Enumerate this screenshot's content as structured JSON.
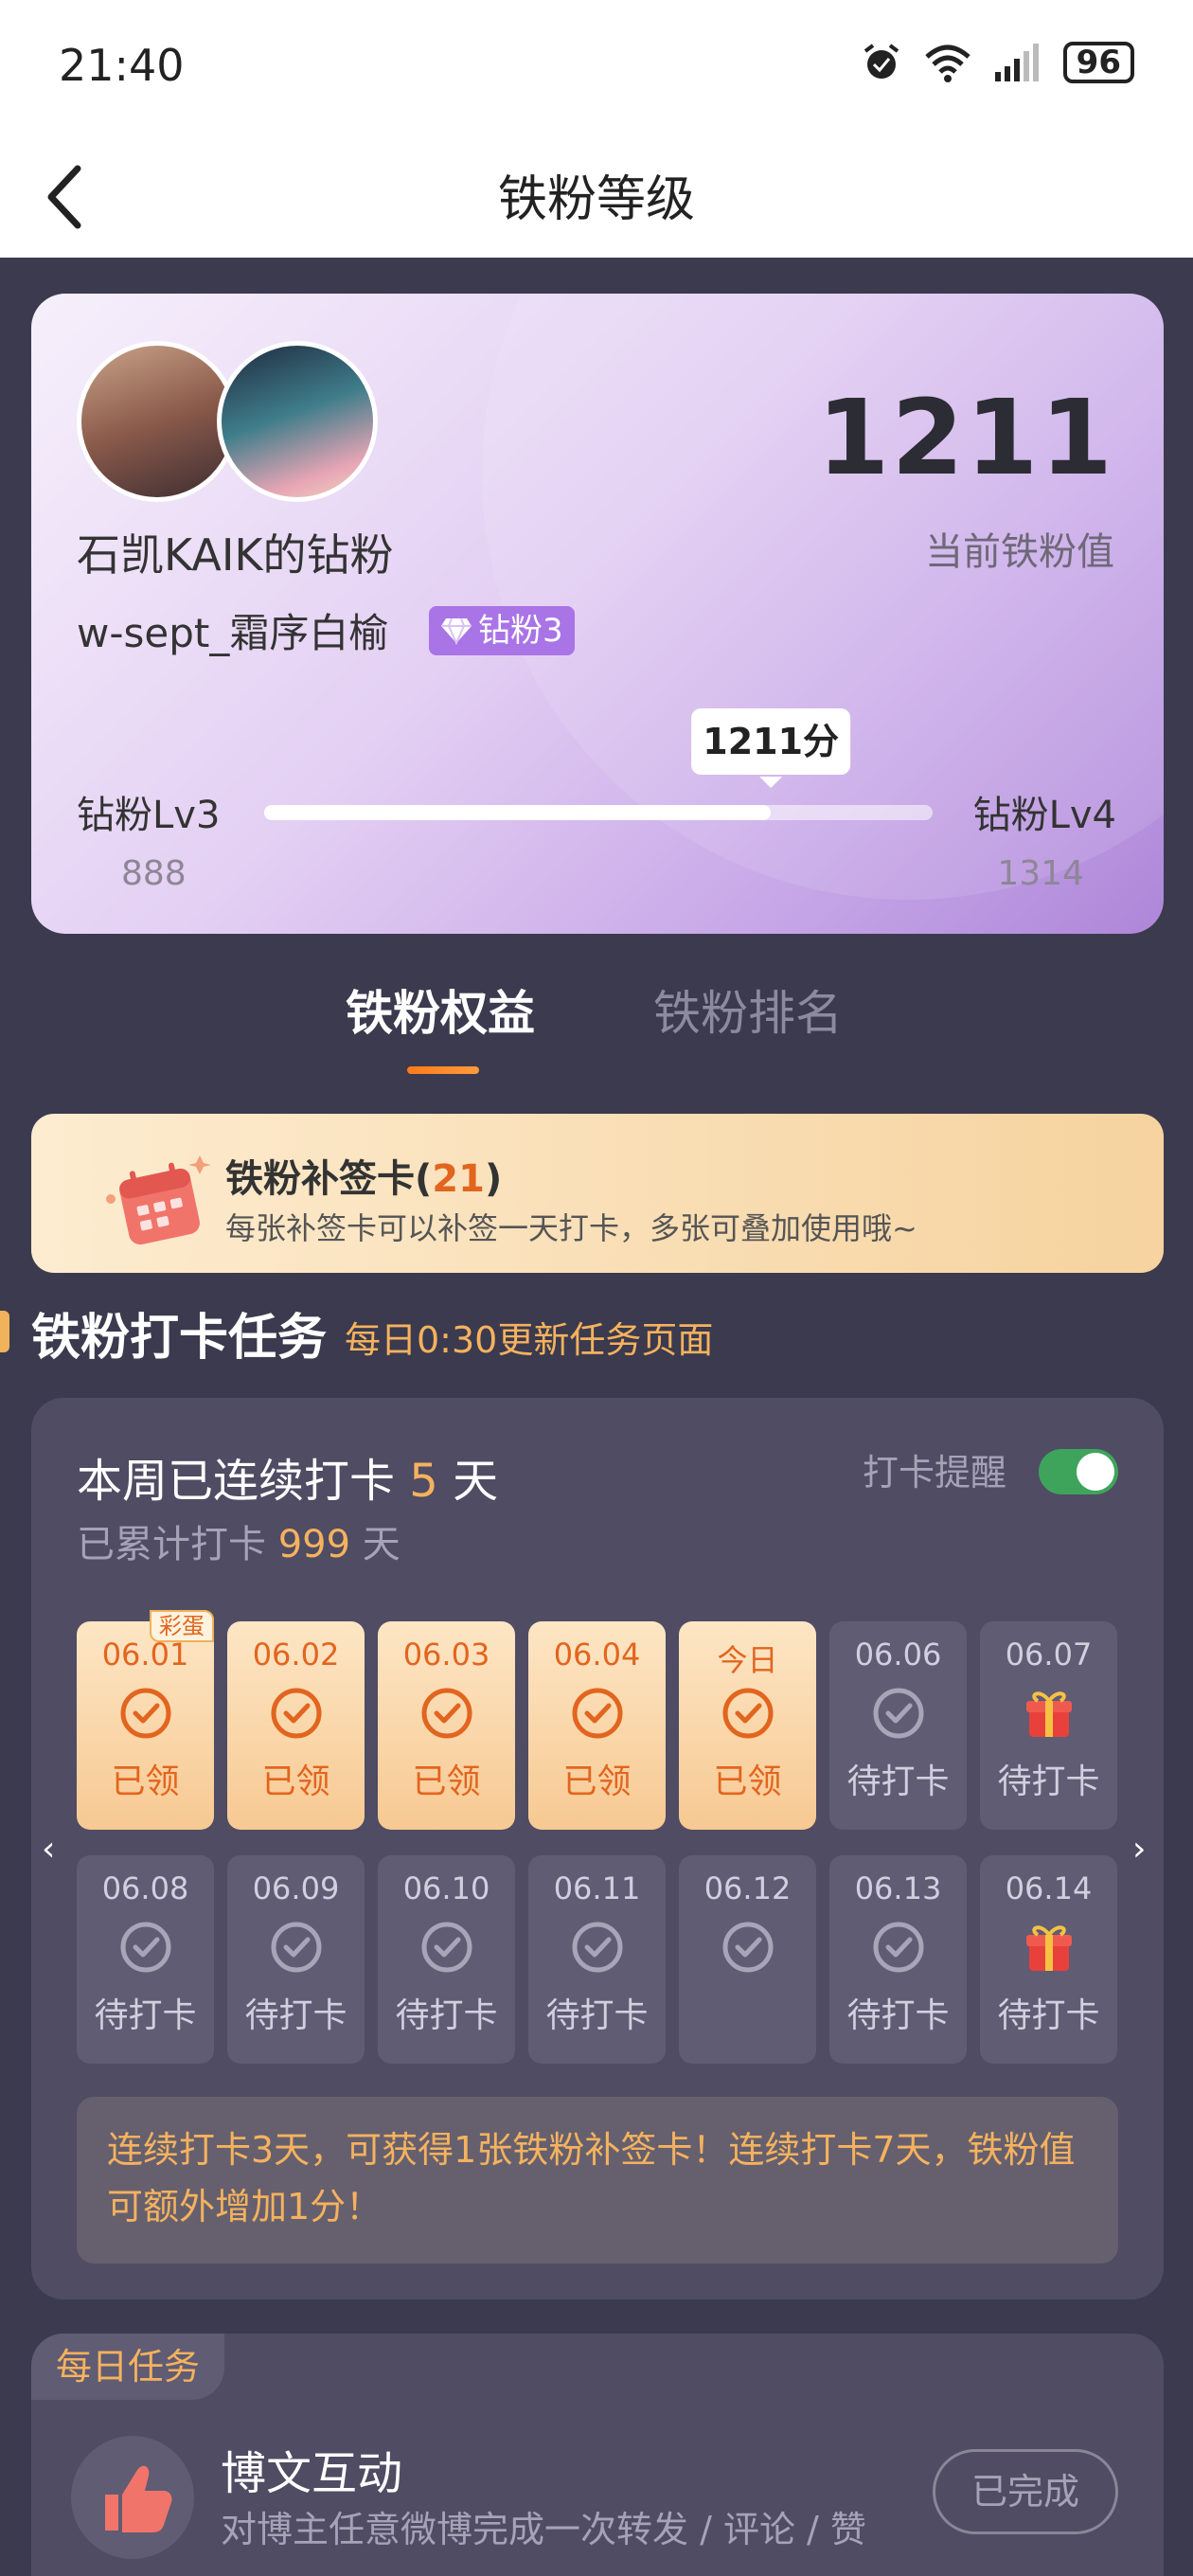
{
  "status_bar": {
    "time": "21:40",
    "battery": "96"
  },
  "nav": {
    "title": "铁粉等级"
  },
  "profile": {
    "fan_name": "石凯KAIK的钻粉",
    "username": "w-sept_霜序白榆",
    "badge": "钻粉3",
    "fan_value": "1211",
    "fan_value_label": "当前铁粉值",
    "level_current": "钻粉Lv3",
    "level_next": "钻粉Lv4",
    "level_min": "888",
    "level_max": "1314",
    "progress_label": "1211分",
    "progress_fraction": 0.758
  },
  "tabs": [
    {
      "label": "铁粉权益"
    },
    {
      "label": "铁粉排名"
    }
  ],
  "makeup_card": {
    "title": "铁粉补签卡(",
    "count": "21",
    "title_end": ")",
    "desc": "每张补签卡可以补签一天打卡，多张可叠加使用哦~"
  },
  "checkin_section": {
    "title": "铁粉打卡任务",
    "subtitle": "每日0:30更新任务页面"
  },
  "checkin": {
    "streak_prefix": "本周已连续打卡 ",
    "streak_days": "5",
    "streak_suffix": " 天",
    "total_prefix": "已累计打卡 ",
    "total_days": "999",
    "total_suffix": " 天",
    "reminder_label": "打卡提醒",
    "reminder_on": true,
    "egg_label": "彩蛋",
    "days": [
      {
        "date": "06.01",
        "status": "已领",
        "type": "done",
        "icon": "check-circle-icon"
      },
      {
        "date": "06.02",
        "status": "已领",
        "type": "done",
        "icon": "check-circle-icon"
      },
      {
        "date": "06.03",
        "status": "已领",
        "type": "done",
        "icon": "check-circle-icon"
      },
      {
        "date": "06.04",
        "status": "已领",
        "type": "done",
        "icon": "check-circle-icon"
      },
      {
        "date": "今日",
        "status": "已领",
        "type": "done",
        "icon": "check-circle-icon"
      },
      {
        "date": "06.06",
        "status": "待打卡",
        "type": "todo",
        "icon": "check-circle-icon"
      },
      {
        "date": "06.07",
        "status": "待打卡",
        "type": "todo",
        "icon": "gift-icon"
      },
      {
        "date": "06.08",
        "status": "待打卡",
        "type": "todo",
        "icon": "check-circle-icon"
      },
      {
        "date": "06.09",
        "status": "待打卡",
        "type": "todo",
        "icon": "check-circle-icon"
      },
      {
        "date": "06.10",
        "status": "待打卡",
        "type": "todo",
        "icon": "check-circle-icon"
      },
      {
        "date": "06.11",
        "status": "待打卡",
        "type": "todo",
        "icon": "check-circle-icon"
      },
      {
        "date": "06.12",
        "status": "",
        "type": "todo",
        "icon": "check-circle-icon"
      },
      {
        "date": "06.13",
        "status": "待打卡",
        "type": "todo",
        "icon": "check-circle-icon"
      },
      {
        "date": "06.14",
        "status": "待打卡",
        "type": "todo",
        "icon": "gift-icon"
      }
    ],
    "tip": "连续打卡3天，可获得1张铁粉补签卡！连续打卡7天，铁粉值可额外增加1分！"
  },
  "daily": {
    "tag": "每日任务",
    "title": "博文互动",
    "desc": "对博主任意微博完成一次转发 / 评论 / 赞",
    "button": "已完成"
  },
  "colors": {
    "accent": "#f5b25e",
    "orange": "#e2651f",
    "purple": "#a974e6",
    "bg": "#3b3a4e"
  }
}
